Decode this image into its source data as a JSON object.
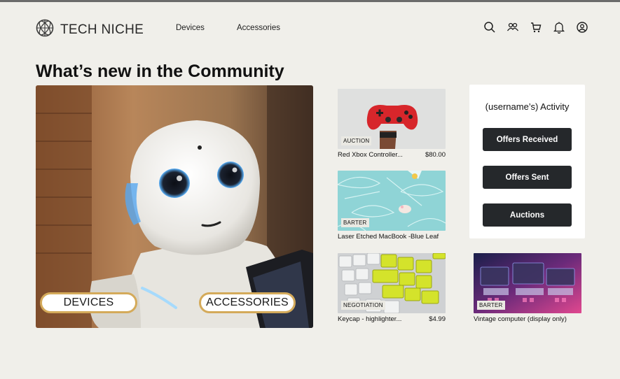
{
  "brand": {
    "name": "TECH NICHE",
    "logo_icon": "globe-icon"
  },
  "nav": {
    "devices": "Devices",
    "accessories": "Accessories"
  },
  "header_icons": [
    "search-icon",
    "community-icon",
    "cart-icon",
    "bell-icon",
    "account-icon"
  ],
  "main": {
    "title": "What’s new in the Community"
  },
  "hero": {
    "devices_label": "DEVICES",
    "accessories_label": "ACCESSORIES"
  },
  "listings": [
    {
      "tag": "AUCTION",
      "title": "Red Xbox Controller...",
      "price": "$80.00"
    },
    {
      "tag": "BARTER",
      "title": "Laser Etched MacBook -Blue Leaf",
      "price": ""
    },
    {
      "tag": "NEGOTIATION",
      "title": "Keycap - highlighter...",
      "price": "$4.99"
    },
    {
      "tag": "BARTER",
      "title": "Vintage computer (display only)",
      "price": ""
    }
  ],
  "activity": {
    "title": "(username’s) Activity",
    "offers_received": "Offers Received",
    "offers_sent": "Offers Sent",
    "auctions": "Auctions"
  },
  "colors": {
    "background": "#f0efea",
    "button_dark": "#25282b",
    "pill_border": "#d4aa5a"
  }
}
